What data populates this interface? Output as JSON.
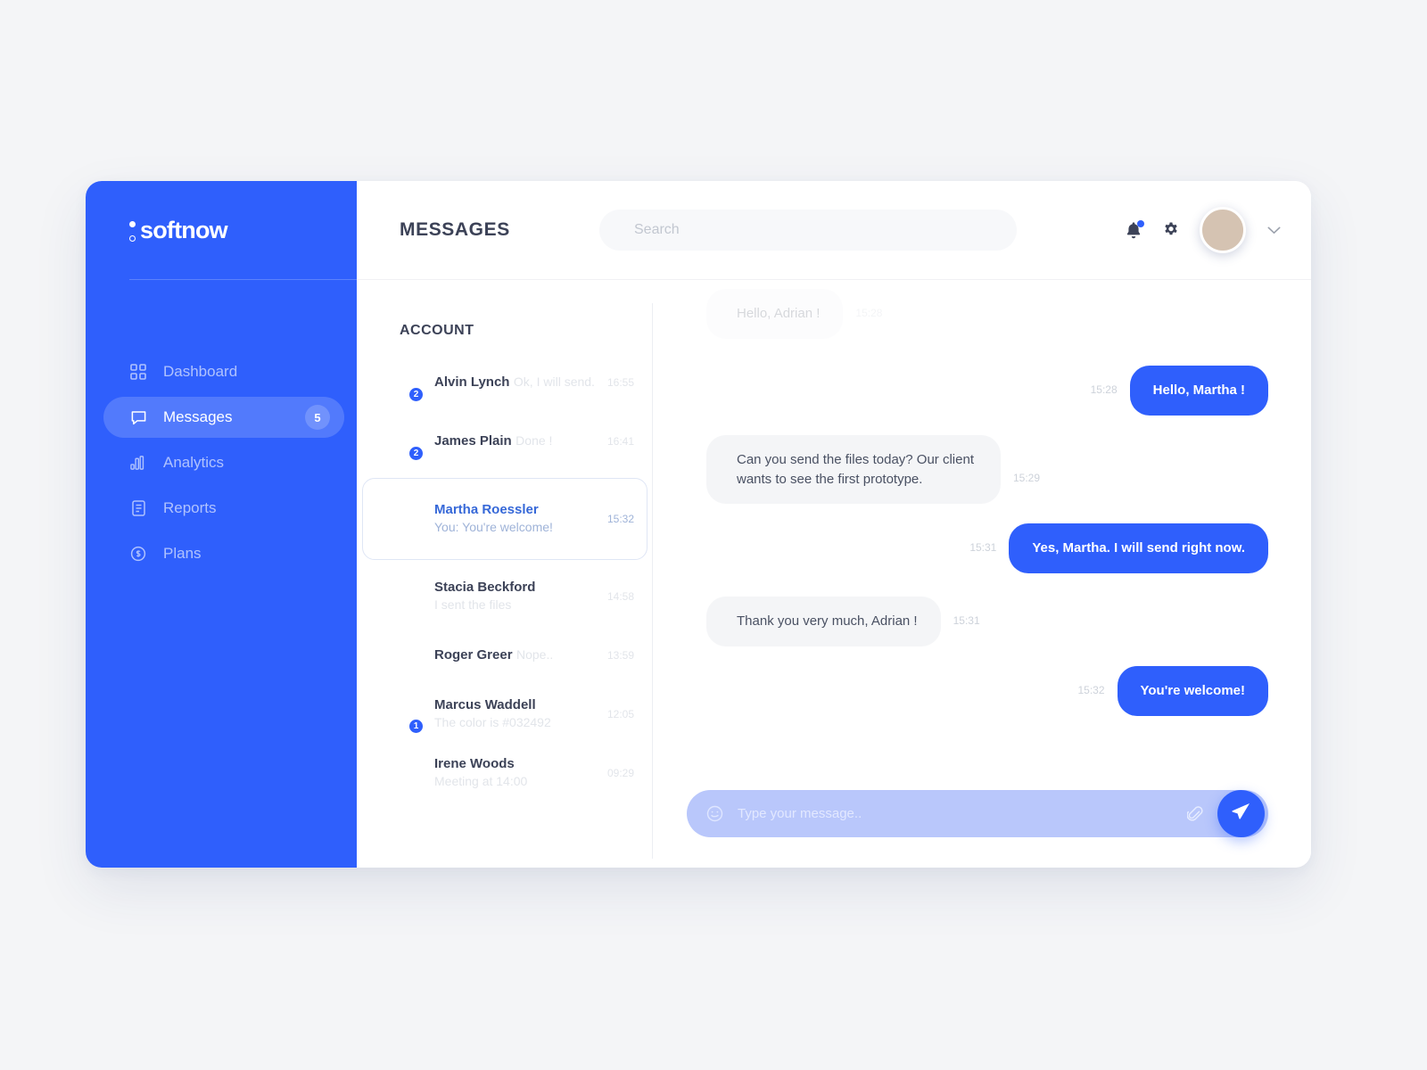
{
  "brand": {
    "logo_text": "softnow",
    "accent": "#2f5ffc",
    "sidebar_bg": "#2f5ffc"
  },
  "sidebar": {
    "items": [
      {
        "label": "Dashboard",
        "icon": "grid-icon",
        "active": false,
        "badge": null
      },
      {
        "label": "Messages",
        "icon": "chat-bubble-icon",
        "active": true,
        "badge": "5"
      },
      {
        "label": "Analytics",
        "icon": "bar-chart-icon",
        "active": false,
        "badge": null
      },
      {
        "label": "Reports",
        "icon": "document-icon",
        "active": false,
        "badge": null
      },
      {
        "label": "Plans",
        "icon": "dollar-circle-icon",
        "active": false,
        "badge": null
      }
    ]
  },
  "topbar": {
    "title": "MESSAGES",
    "search_placeholder": "Search",
    "search_value": "",
    "bell_icon": "notification-bell-icon",
    "bell_has_unread": true,
    "settings_icon": "gear-icon",
    "avatar": "user-avatar",
    "chevron": "chevron-down-icon"
  },
  "contacts": {
    "title": "ACCOUNT",
    "items": [
      {
        "name": "Alvin Lynch",
        "preview": "Ok, I will send.",
        "time": "16:55",
        "badge": "2",
        "face": "f-alvin",
        "selected": false,
        "faded": true
      },
      {
        "name": "James Plain",
        "preview": "Done !",
        "time": "16:41",
        "badge": "2",
        "face": "f-james",
        "selected": false,
        "faded": true
      },
      {
        "name": "Martha Roessler",
        "preview": "You: You're welcome!",
        "time": "15:32",
        "badge": null,
        "face": "f-martha",
        "selected": true,
        "faded": false
      },
      {
        "name": "Stacia Beckford",
        "preview": "I sent the files",
        "time": "14:58",
        "badge": null,
        "face": "f-stacia",
        "selected": false,
        "faded": true
      },
      {
        "name": "Roger Greer",
        "preview": "Nope..",
        "time": "13:59",
        "badge": null,
        "face": "f-roger",
        "selected": false,
        "faded": true
      },
      {
        "name": "Marcus Waddell",
        "preview": "The color is #032492",
        "time": "12:05",
        "badge": "1",
        "face": "f-marcus",
        "selected": false,
        "faded": true
      },
      {
        "name": "Irene Woods",
        "preview": "Meeting at 14:00",
        "time": "09:29",
        "badge": null,
        "face": "f-irene",
        "selected": false,
        "faded": true
      }
    ]
  },
  "chat": {
    "messages": [
      {
        "direction": "inbound",
        "text": "Hello, Adrian !",
        "time": "15:28",
        "avatar": "f-martha",
        "faded": true
      },
      {
        "direction": "outbound",
        "text": "Hello, Martha !",
        "time": "15:28",
        "avatar": null,
        "faded": false
      },
      {
        "direction": "inbound",
        "text": "Can you send the files today? Our client wants to see the first prototype.",
        "time": "15:29",
        "avatar": "f-martha",
        "faded": false
      },
      {
        "direction": "outbound",
        "text": "Yes, Martha. I will send right now.",
        "time": "15:31",
        "avatar": null,
        "faded": false
      },
      {
        "direction": "inbound",
        "text": "Thank you very much, Adrian !",
        "time": "15:31",
        "avatar": "f-martha",
        "faded": false
      },
      {
        "direction": "outbound",
        "text": "You're welcome!",
        "time": "15:32",
        "avatar": null,
        "faded": false
      }
    ]
  },
  "composer": {
    "placeholder": "Type your message..",
    "value": "",
    "emoji_icon": "smiley-icon",
    "attach_icon": "paperclip-icon",
    "send_icon": "send-paper-plane-icon"
  }
}
